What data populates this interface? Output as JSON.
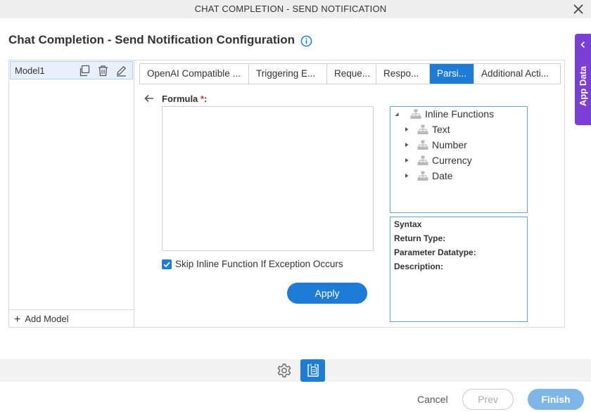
{
  "window": {
    "title": "CHAT COMPLETION - SEND NOTIFICATION",
    "close_icon": "close-icon"
  },
  "page": {
    "heading": "Chat Completion - Send Notification Configuration",
    "info_icon": "info-icon"
  },
  "app_data_panel": {
    "label": "App Data",
    "icon": "chevron-left-icon",
    "color": "#7b3fd4"
  },
  "models": {
    "items": [
      {
        "name": "Model1",
        "icons": [
          "copy-icon",
          "delete-icon",
          "edit-icon"
        ]
      }
    ],
    "add_label": "Add Model"
  },
  "tabs": [
    {
      "label": "OpenAI Compatible ...",
      "active": false
    },
    {
      "label": "Triggering E...",
      "active": false
    },
    {
      "label": "Reque...",
      "active": false
    },
    {
      "label": "Respo...",
      "active": false
    },
    {
      "label": "Parsi...",
      "active": true
    },
    {
      "label": "Additional Acti...",
      "active": false
    }
  ],
  "formula": {
    "label": "Formula",
    "required_mark": "*",
    "label_suffix": ":",
    "value": ""
  },
  "skip_option": {
    "label": "Skip Inline Function If Exception Occurs",
    "checked": true
  },
  "apply_label": "Apply",
  "function_tree": {
    "root": "Inline Functions",
    "children": [
      "Text",
      "Number",
      "Currency",
      "Date"
    ]
  },
  "syntax_panel": {
    "syntax": "Syntax",
    "return_type": "Return Type:",
    "parameter_datatype": "Parameter Datatype:",
    "description": "Description:"
  },
  "footer": {
    "cancel": "Cancel",
    "prev": "Prev",
    "finish": "Finish"
  },
  "colors": {
    "accent": "#1c7cd6",
    "finish_disabled": "#7fb6e8",
    "tree_border": "#6aa3c8"
  }
}
